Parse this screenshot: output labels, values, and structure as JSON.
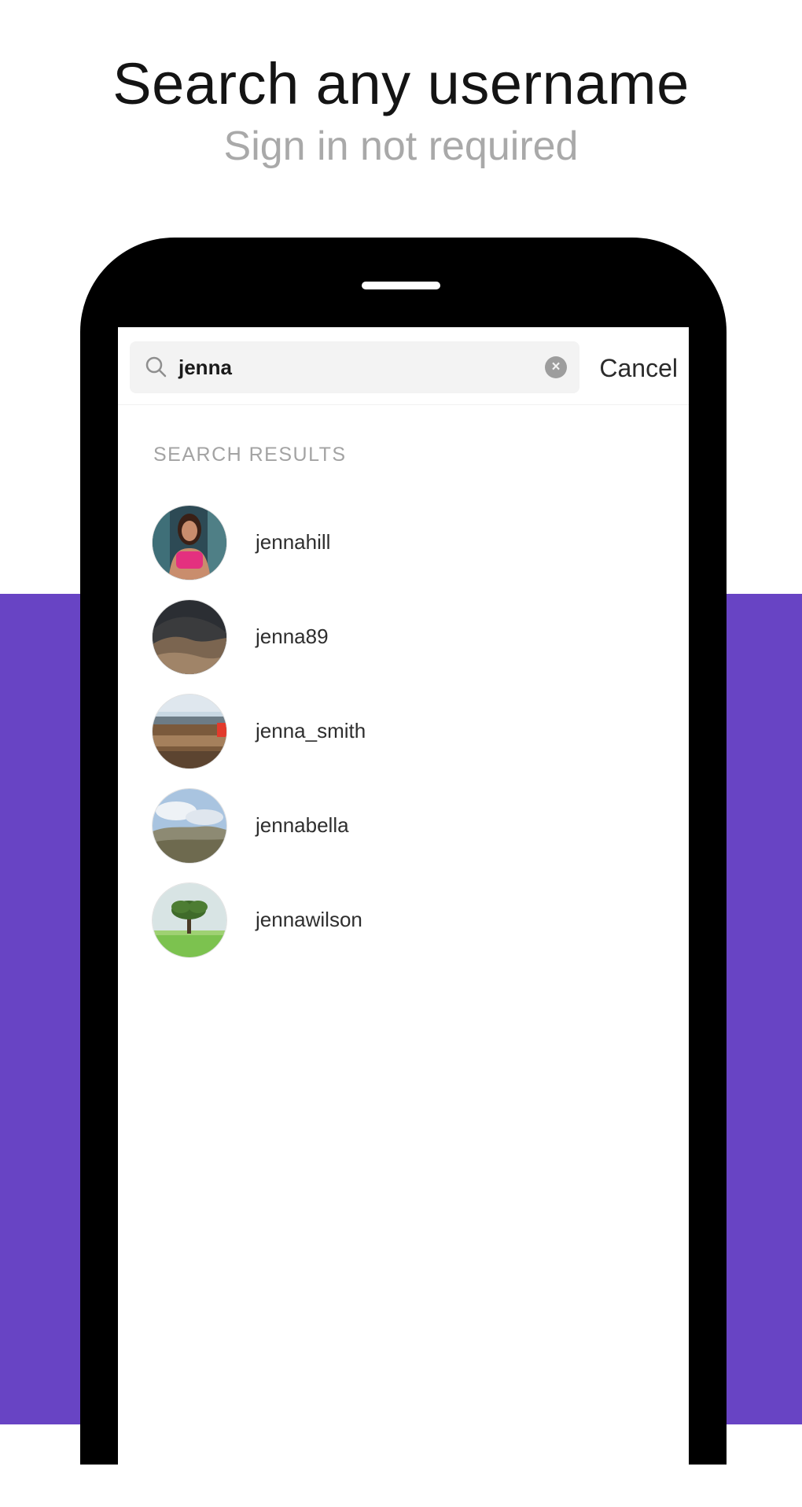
{
  "header": {
    "title": "Search any username",
    "subtitle": "Sign in not required"
  },
  "search": {
    "query": "jenna",
    "cancel_label": "Cancel",
    "search_icon": "search-icon",
    "clear_icon": "clear-icon"
  },
  "results": {
    "section_title": "SEARCH RESULTS",
    "items": [
      {
        "username": "jennahill",
        "avatar": "woman-portrait-photo"
      },
      {
        "username": "jenna89",
        "avatar": "rocky-landscape-photo"
      },
      {
        "username": "jenna_smith",
        "avatar": "canyon-landscape-photo"
      },
      {
        "username": "jennabella",
        "avatar": "hills-sky-photo"
      },
      {
        "username": "jennawilson",
        "avatar": "tree-field-photo"
      }
    ]
  },
  "colors": {
    "accent_purple": "#6844c4",
    "phone_frame": "#000000",
    "search_field_bg": "#f3f3f3"
  }
}
